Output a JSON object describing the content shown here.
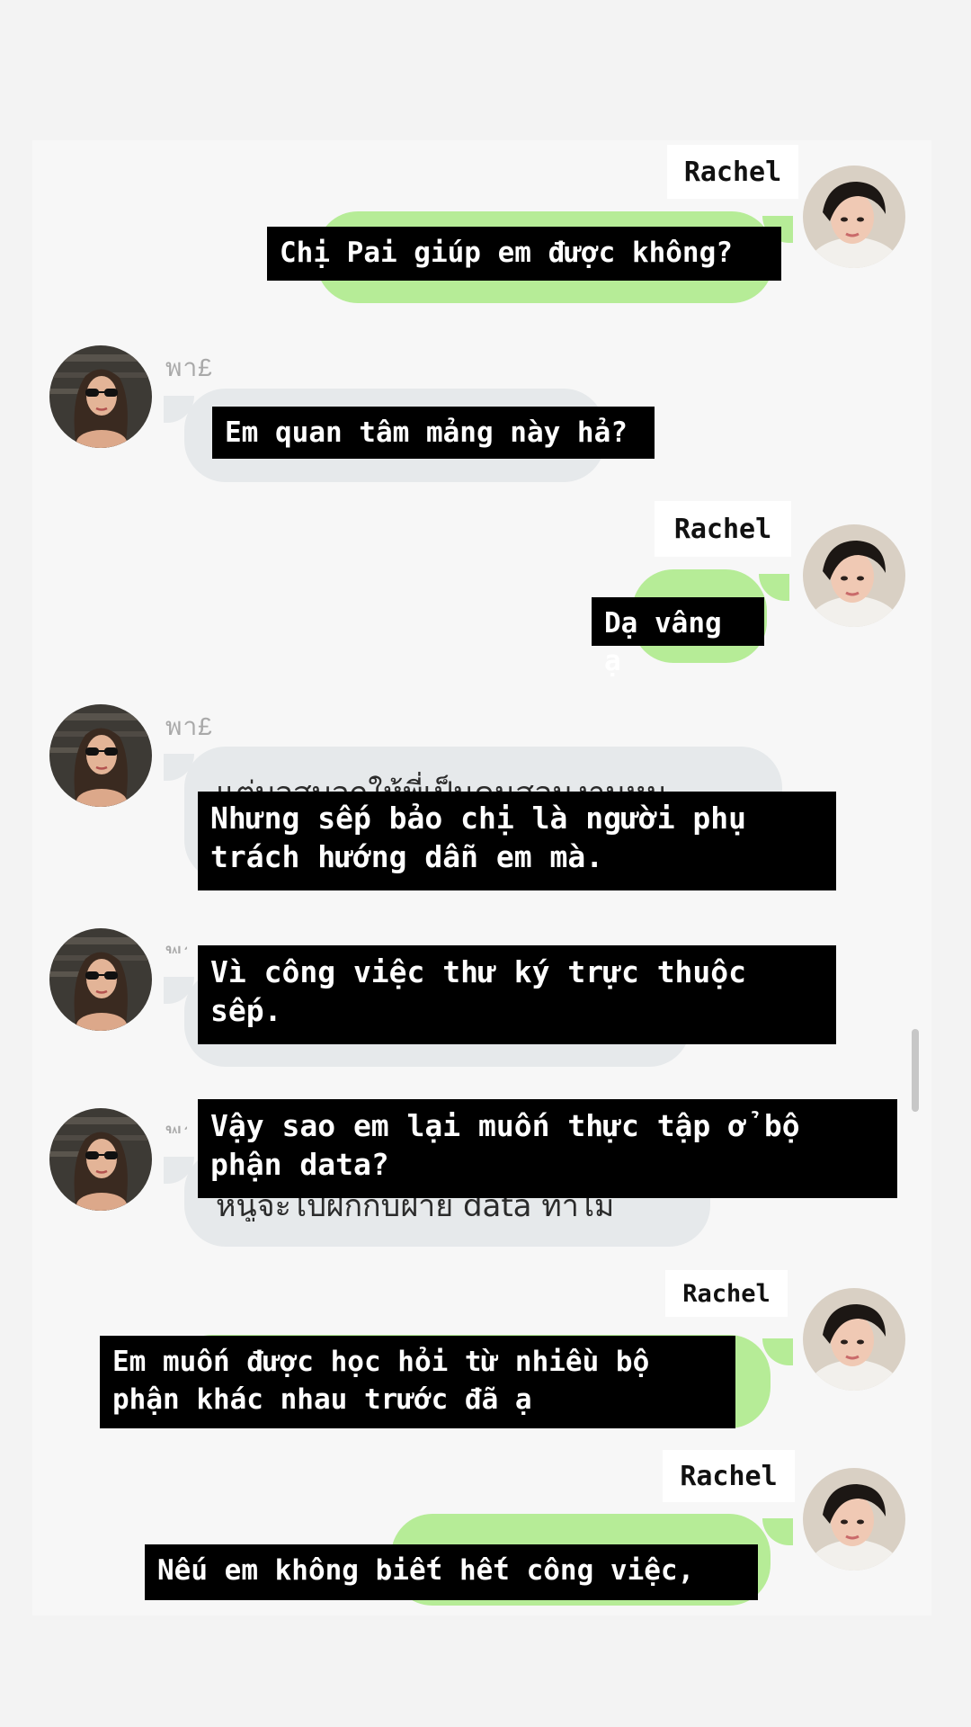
{
  "chat": {
    "messages": [
      {
        "sender": "Rachel",
        "direction": "outgoing",
        "subtitle": "Chị Pai giúp em được không?"
      },
      {
        "sender": "พา£",
        "direction": "incoming",
        "subtitle": "Em quan tâm mảng này hả?"
      },
      {
        "sender": "Rachel",
        "direction": "outgoing",
        "subtitle": "Dạ vâng ạ"
      },
      {
        "sender": "พา£",
        "direction": "incoming",
        "bubble_text_partial": "แต่บอสบอกให้พี่เป็นคนสอนงานหนู",
        "subtitle": "Nhưng sếp bảo chị là người phụ\ntrách hướng dẫn em mà."
      },
      {
        "sender": "พา£",
        "direction": "incoming",
        "subtitle": "Vì công việc thư ký trực thuộc\nsếp."
      },
      {
        "sender": "พา£",
        "direction": "incoming",
        "bubble_text_partial": "หนูจะไปฝึกกับฝ่าย data ทำไม",
        "subtitle": "Vậy sao em lại muốn thực tập ở bộ\nphận data?"
      },
      {
        "sender": "Rachel",
        "direction": "outgoing",
        "subtitle": "Em muốn được học hỏi từ nhiều bộ\nphận khác nhau trước đã ạ"
      },
      {
        "sender": "Rachel",
        "direction": "outgoing",
        "subtitle": "Nếu em không biết hết công việc,"
      }
    ]
  },
  "colors": {
    "outgoing_bubble": "#b6ec97",
    "incoming_bubble": "#e6e9eb",
    "subtitle_bg": "#000000",
    "subtitle_text": "#ffffff",
    "name_tag_bg": "#ffffff"
  }
}
